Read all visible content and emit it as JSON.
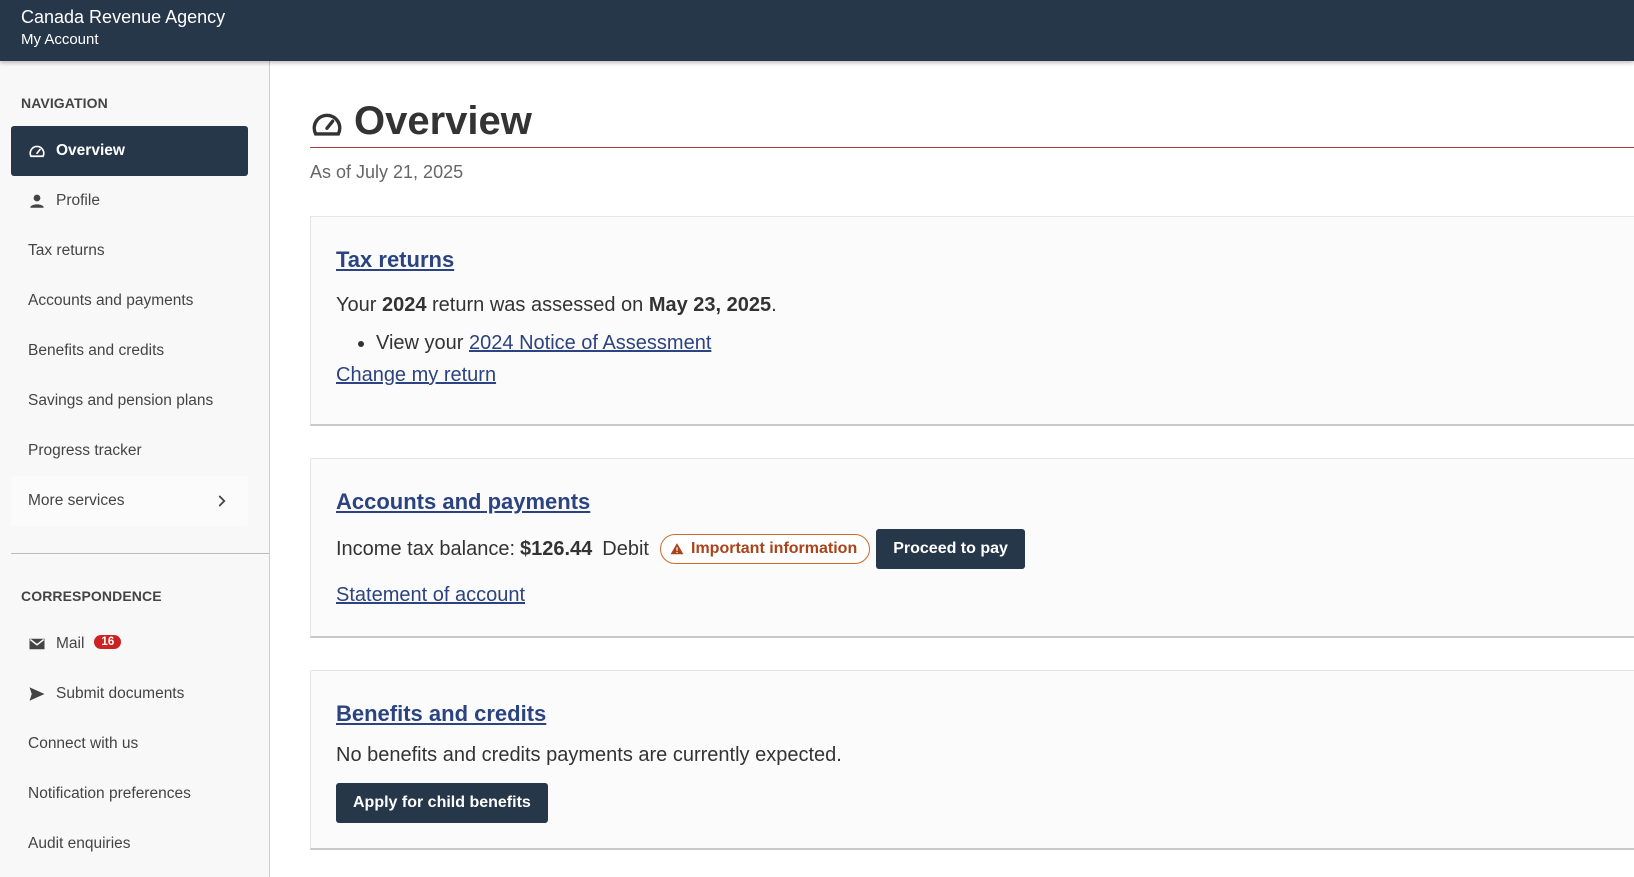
{
  "header": {
    "agency": "Canada Revenue Agency",
    "account": "My Account"
  },
  "sidebar": {
    "navigation_heading": "NAVIGATION",
    "nav_items": [
      {
        "label": "Overview",
        "icon": "gauge-icon",
        "active": true
      },
      {
        "label": "Profile",
        "icon": "person-icon"
      },
      {
        "label": "Tax returns"
      },
      {
        "label": "Accounts and payments"
      },
      {
        "label": "Benefits and credits"
      },
      {
        "label": "Savings and pension plans"
      },
      {
        "label": "Progress tracker"
      },
      {
        "label": "More services",
        "icon": "chevron-right-icon"
      }
    ],
    "correspondence_heading": "CORRESPONDENCE",
    "correspondence_items": [
      {
        "label": "Mail",
        "icon": "envelope-icon",
        "badge": "16"
      },
      {
        "label": "Submit documents",
        "icon": "send-icon"
      },
      {
        "label": "Connect with us"
      },
      {
        "label": "Notification preferences"
      },
      {
        "label": "Audit enquiries"
      }
    ]
  },
  "main": {
    "title": "Overview",
    "title_icon": "gauge-icon",
    "as_of": "As of July 21, 2025",
    "tax_returns": {
      "title": "Tax returns",
      "text_1": "Your ",
      "year": "2024",
      "text_2": " return was assessed on ",
      "date": "May 23, 2025",
      "text_3": ".",
      "bullet_prefix": "View your ",
      "notice_link": "2024 Notice of Assessment",
      "change_link": "Change my return"
    },
    "accounts": {
      "title": "Accounts and payments",
      "balance_label": "Income tax balance: ",
      "balance_amount": "$126.44",
      "balance_type": "Debit",
      "warning_label": "Important information",
      "warning_icon": "warning-icon",
      "pay_button": "Proceed to pay",
      "statement_link": "Statement of account"
    },
    "benefits": {
      "title": "Benefits and credits",
      "text": "No benefits and credits payments are currently expected.",
      "apply_button": "Apply for child benefits"
    }
  },
  "colors": {
    "header_bg": "#26374a",
    "link": "#2b4380",
    "badge": "#cc2222",
    "warning": "#a8431b",
    "title_rule": "#af3c43"
  }
}
